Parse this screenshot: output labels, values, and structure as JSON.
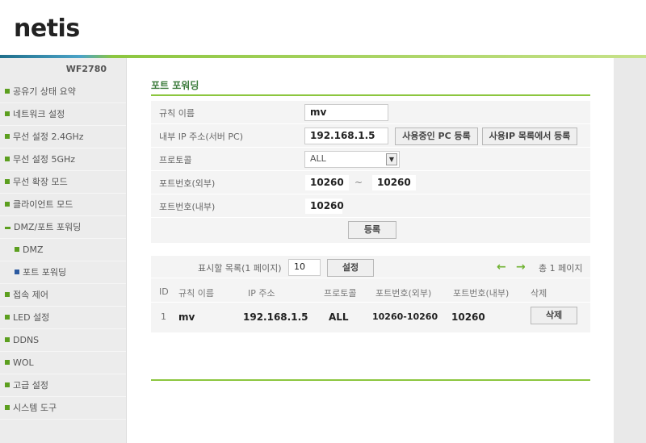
{
  "brand": {
    "logo": "netis"
  },
  "sidebar": {
    "model": "WF2780",
    "items": [
      {
        "label": "공유기 상태 요약"
      },
      {
        "label": "네트워크 설정"
      },
      {
        "label": "무선 설정 2.4GHz"
      },
      {
        "label": "무선 설정 5GHz"
      },
      {
        "label": "무선 확장 모드"
      },
      {
        "label": "클라이언트 모드"
      },
      {
        "label": "DMZ/포트 포워딩"
      },
      {
        "label": "DMZ"
      },
      {
        "label": "포트 포워딩"
      },
      {
        "label": "접속 제어"
      },
      {
        "label": "LED 설정"
      },
      {
        "label": "DDNS"
      },
      {
        "label": "WOL"
      },
      {
        "label": "고급 설정"
      },
      {
        "label": "시스템 도구"
      }
    ]
  },
  "page": {
    "title": "포트 포워딩"
  },
  "form": {
    "rule_name_label": "규칙 이름",
    "rule_name_value": "mv",
    "internal_ip_label": "내부 IP 주소(서버 PC)",
    "internal_ip_value": "192.168.1.5",
    "register_current_pc": "사용중인 PC 등록",
    "register_from_ip_list": "사용IP 목록에서 등록",
    "protocol_label": "프로토콜",
    "protocol_value": "ALL",
    "external_port_label": "포트번호(외부)",
    "external_port_from": "10260",
    "port_range_sep": "~",
    "external_port_to": "10260",
    "internal_port_label": "포트번호(내부)",
    "internal_port_value": "10260",
    "register_button": "등록"
  },
  "list": {
    "per_page_label": "표시할 목록(1 페이지)",
    "per_page_value": "10",
    "set_button": "설정",
    "page_info": "총 1 페이지",
    "prev_arrow": "←",
    "next_arrow": "→",
    "columns": [
      "ID",
      "규칙 이름",
      "IP 주소",
      "프로토콜",
      "포트번호(외부)",
      "포트번호(내부)",
      "삭제"
    ],
    "rows": [
      {
        "id": "1",
        "name": "mv",
        "ip": "192.168.1.5",
        "protocol": "ALL",
        "ext_port": "10260-10260",
        "int_port": "10260",
        "delete_label": "삭제"
      }
    ]
  },
  "colors": {
    "accent_green": "#8cc63f",
    "title_green": "#3a7a3a",
    "bullet_green": "#5c9f1f",
    "bullet_blue": "#2c5aa0"
  }
}
